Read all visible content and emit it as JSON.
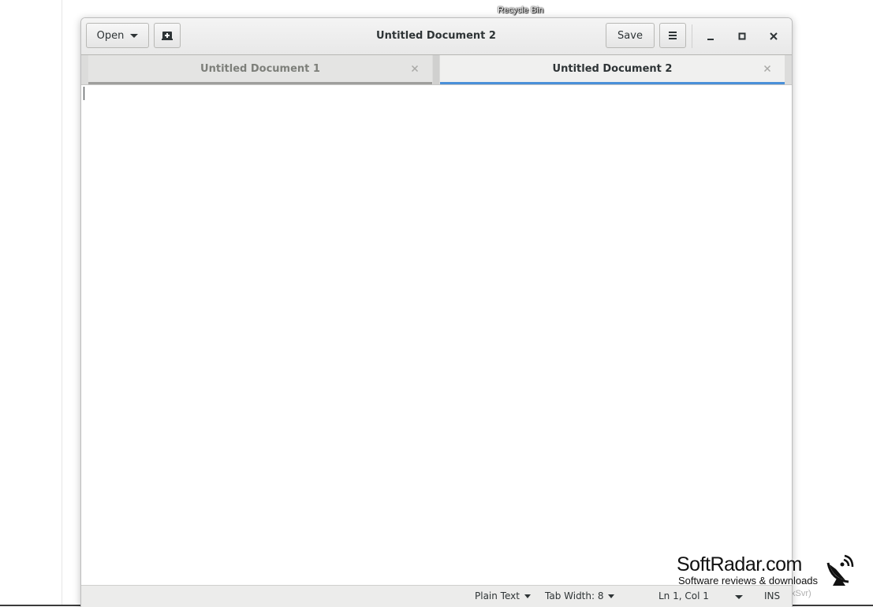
{
  "desktop": {
    "recycle_bin_label": "Recycle Bin",
    "background_text": "xSvr)"
  },
  "window": {
    "title": "Untitled Document 2",
    "open_label": "Open",
    "new_document_icon": "new-document-icon",
    "save_label": "Save",
    "menu_icon": "hamburger-menu-icon",
    "accent_color": "#4a90d9"
  },
  "tabs": [
    {
      "label": "Untitled Document 1",
      "active": false
    },
    {
      "label": "Untitled Document 2",
      "active": true
    }
  ],
  "editor": {
    "content": ""
  },
  "statusbar": {
    "language": "Plain Text",
    "tab_width": "Tab Width: 8",
    "position": "Ln 1, Col 1",
    "mode": "INS"
  },
  "watermark": {
    "title": "SoftRadar.com",
    "subtitle": "Software reviews & downloads"
  }
}
